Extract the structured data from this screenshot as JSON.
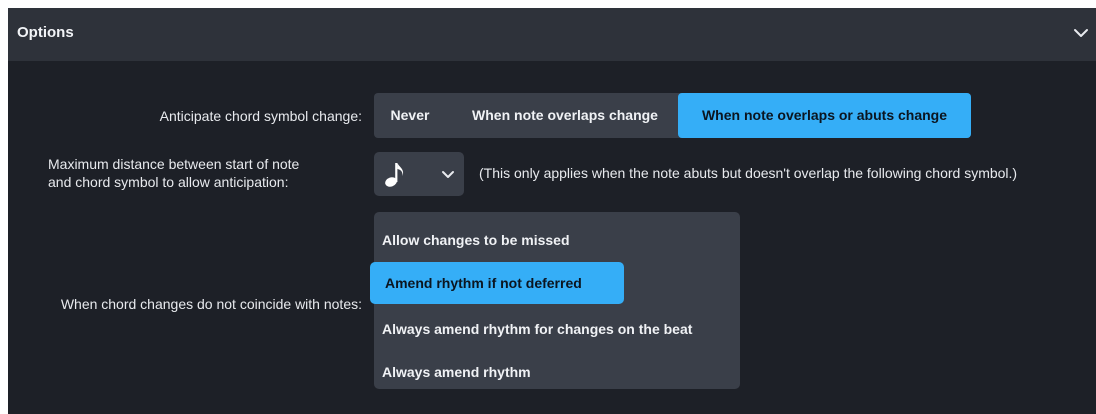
{
  "panel": {
    "title": "Options",
    "collapse_icon": "chevron-down-icon"
  },
  "anticipate": {
    "label": "Anticipate chord symbol change:",
    "options": [
      "Never",
      "When note overlaps change",
      "When note overlaps or abuts change"
    ],
    "selected": "When note overlaps or abuts change"
  },
  "max_distance": {
    "label_line1": "Maximum distance between start of note",
    "label_line2": "and chord symbol to allow anticipation:",
    "value_icon": "eighth-note-icon",
    "chevron_icon": "chevron-down-icon",
    "hint": "(This only applies when the note abuts but doesn't overlap the following chord symbol.)"
  },
  "not_coincide": {
    "label": "When chord changes do not coincide with notes:",
    "options": [
      "Allow changes to be missed",
      "Amend rhythm if not deferred",
      "Always amend rhythm for changes on the beat",
      "Always amend rhythm"
    ],
    "selected": "Amend rhythm if not deferred"
  },
  "colors": {
    "accent": "#35aef7",
    "panel_bg": "#1d2027",
    "header_bg": "#2e323a",
    "control_bg": "#3a3f49"
  }
}
